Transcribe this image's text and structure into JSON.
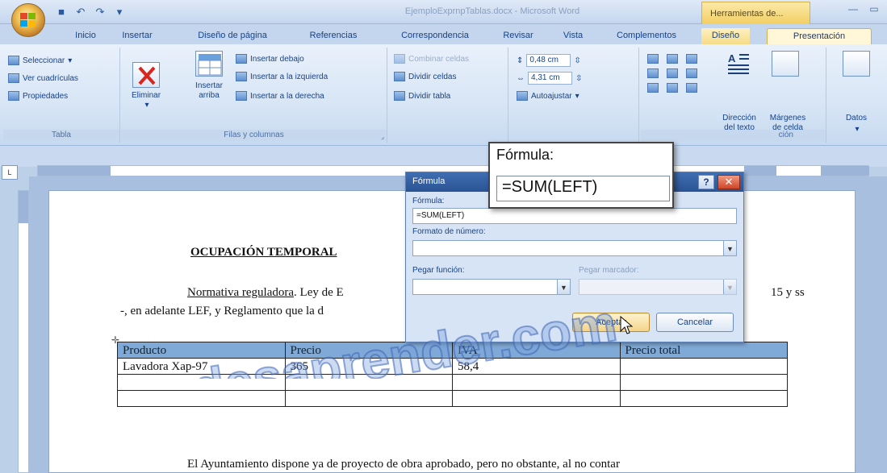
{
  "window": {
    "title": "EjemploExprnpTablas.docx - Microsoft Word",
    "context_tab_header": "Herramientas de...",
    "qat_icons": [
      "save-icon",
      "undo-icon",
      "redo-icon"
    ]
  },
  "tabs": [
    {
      "label": "Inicio"
    },
    {
      "label": "Insertar"
    },
    {
      "label": "Diseño de página"
    },
    {
      "label": "Referencias"
    },
    {
      "label": "Correspondencia"
    },
    {
      "label": "Revisar"
    },
    {
      "label": "Vista"
    },
    {
      "label": "Complementos"
    },
    {
      "label": "Diseño"
    },
    {
      "label": "Presentación"
    }
  ],
  "ribbon": {
    "tabla": {
      "label": "Tabla",
      "items": [
        "Seleccionar",
        "Ver cuadrículas",
        "Propiedades"
      ]
    },
    "filas": {
      "label": "Filas y columnas",
      "eliminar": "Eliminar",
      "insertar_arriba_1": "Insertar",
      "insertar_arriba_2": "arriba",
      "items": [
        "Insertar debajo",
        "Insertar a la izquierda",
        "Insertar a la derecha"
      ]
    },
    "combinar": {
      "items": [
        "Combinar celdas",
        "Dividir celdas",
        "Dividir tabla"
      ]
    },
    "tamano": {
      "height": "0,48 cm",
      "width": "4,31 cm",
      "autoajustar": "Autoajustar"
    },
    "alineacion": {
      "label": "ción",
      "direccion_1": "Dirección",
      "direccion_2": "del texto",
      "margenes_1": "Márgenes",
      "margenes_2": "de celda"
    },
    "datos": {
      "label": "Datos"
    }
  },
  "document": {
    "heading": "OCUPACIÓN TEMPORAL",
    "p1_underlined": "Normativa reguladora",
    "p1_rest": ". Ley de E",
    "p1_end": "15 y ss",
    "p2": "-, en adelante LEF, y Reglamento que la d",
    "p3": "El Ayuntamiento dispone ya de proyecto de obra aprobado, pero no obstante, al no contar",
    "table": {
      "headers": [
        "Producto",
        "Precio",
        "IVA",
        "Precio total"
      ],
      "row1": [
        "Lavadora Xap-97",
        "365",
        "58,4",
        ""
      ]
    }
  },
  "dialog": {
    "title": "Fórmula",
    "formula_label": "Fórmula:",
    "formula_value": "=SUM(LEFT)",
    "format_label": "Formato de número:",
    "paste_function_label": "Pegar función:",
    "paste_bookmark_label": "Pegar marcador:",
    "ok": "Aceptar",
    "cancel": "Cancelar"
  },
  "zoom": {
    "label": "Fórmula:",
    "value": "=SUM(LEFT)"
  },
  "watermark": {
    "text": "www.desaprender.com"
  }
}
